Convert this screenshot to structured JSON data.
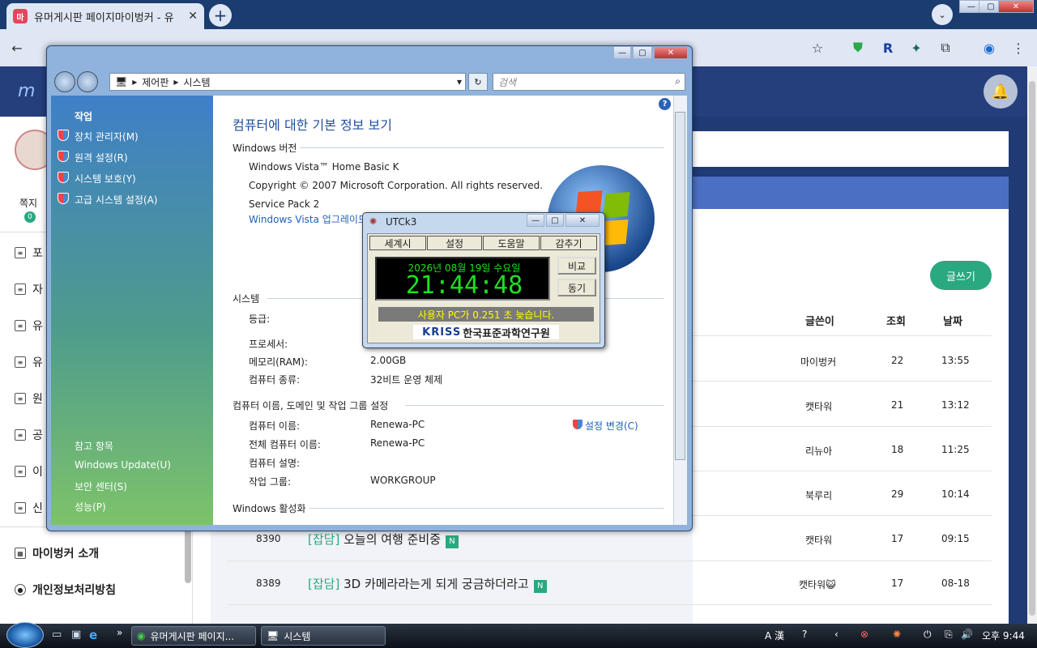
{
  "browser": {
    "tab_title": "유머게시판 페이지마이벙커 - 유",
    "tab_favicon": "마",
    "window_controls": [
      "—",
      "▢",
      "✕"
    ]
  },
  "site": {
    "logo": "m",
    "sidebar": {
      "message_label": "쪽지",
      "message_count": "0",
      "items": [
        "포",
        "자",
        "유",
        "유",
        "원",
        "공",
        "이",
        "신"
      ],
      "footer": [
        "마이벙커 소개",
        "개인정보처리방침"
      ]
    },
    "write_button": "글쓰기",
    "columns": {
      "author": "글쓴이",
      "views": "조회",
      "date": "날짜"
    },
    "rows": [
      {
        "num": "",
        "author": "마이벙커",
        "views": "22",
        "date": "13:55"
      },
      {
        "num": "",
        "author": "캣타워",
        "views": "21",
        "date": "13:12"
      },
      {
        "num": "",
        "author": "리뉴아",
        "views": "18",
        "date": "11:25"
      },
      {
        "num": "",
        "author": "북루리",
        "views": "29",
        "date": "10:14"
      },
      {
        "num": "8390",
        "category": "[잡담]",
        "title": "오늘의 여행 준비중",
        "author": "캣타워",
        "views": "17",
        "date": "09:15"
      },
      {
        "num": "8389",
        "category": "[잡담]",
        "title": "3D 카메라라는게 되게 궁금하더라고",
        "author": "캣타워😺",
        "views": "17",
        "date": "08-18"
      }
    ],
    "new_badge": "N"
  },
  "vista": {
    "breadcrumb": [
      "제어판",
      "시스템"
    ],
    "search_placeholder": "검색",
    "tasks_heading": "작업",
    "tasks": [
      "장치 관리자(M)",
      "원격 설정(R)",
      "시스템 보호(Y)",
      "고급 시스템 설정(A)"
    ],
    "see_also_heading": "참고 항목",
    "see_also": [
      "Windows Update(U)",
      "보안 센터(S)",
      "성능(P)"
    ],
    "title": "컴퓨터에 대한 기본 정보 보기",
    "sec_edition": "Windows 버전",
    "edition": "Windows Vista™ Home Basic K",
    "copyright": "Copyright © 2007 Microsoft Corporation.  All rights reserved.",
    "service_pack": "Service Pack 2",
    "upgrade_link": "Windows Vista 업그레이드",
    "sec_system": "시스템",
    "rating_label": "등급:",
    "processor_label": "프로세서:",
    "memory_label": "메모리(RAM):",
    "memory_value": "2.00GB",
    "type_label": "컴퓨터 종류:",
    "type_value": "32비트 운영 체제",
    "sec_computer": "컴퓨터 이름, 도메인 및 작업 그룹 설정",
    "name_label": "컴퓨터 이름:",
    "name_value": "Renewa-PC",
    "fullname_label": "전체 컴퓨터 이름:",
    "fullname_value": "Renewa-PC",
    "desc_label": "컴퓨터 설명:",
    "workgroup_label": "작업 그룹:",
    "workgroup_value": "WORKGROUP",
    "change_link": "설정 변경(C)",
    "sec_activation": "Windows 활성화"
  },
  "utck": {
    "title": "UTCk3",
    "tabs": [
      "세계시",
      "설정",
      "도움말",
      "감추기"
    ],
    "date": "2026년 08월 19일 수요일",
    "time": "21:44:48",
    "compare": "비교",
    "sync": "동기",
    "status": "사용자 PC가 0.251 초 늦습니다.",
    "logo_left": "KRISS",
    "logo_right": "한국표준과학연구원"
  },
  "taskbar": {
    "items": [
      "유머게시판 페이지...",
      "시스템"
    ],
    "ime": "A 漢",
    "clock": "오후 9:44"
  }
}
